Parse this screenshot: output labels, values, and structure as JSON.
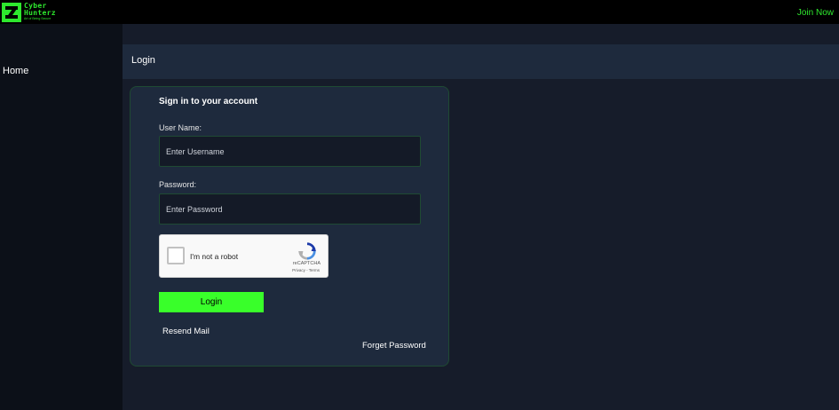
{
  "brand": {
    "line1": "Cyber",
    "line2": "Hunterz",
    "tagline": "Art of Being Secure",
    "accent": "#2ee82e"
  },
  "topbar": {
    "join_label": "Join Now"
  },
  "sidebar": {
    "items": [
      {
        "label": "Home"
      }
    ]
  },
  "page": {
    "title": "Login"
  },
  "login_form": {
    "heading": "Sign in to your account",
    "username_label": "User Name:",
    "username_placeholder": "Enter Username",
    "username_value": "",
    "password_label": "Password:",
    "password_placeholder": "Enter Password",
    "password_value": "",
    "captcha": {
      "label": "I'm not a robot",
      "brand": "reCAPTCHA",
      "links": "Privacy - Terms",
      "icon": "recaptcha-icon"
    },
    "submit_label": "Login",
    "button_color": "#39ff2a",
    "resend_label": "Resend Mail",
    "forget_label": "Forget Password"
  }
}
